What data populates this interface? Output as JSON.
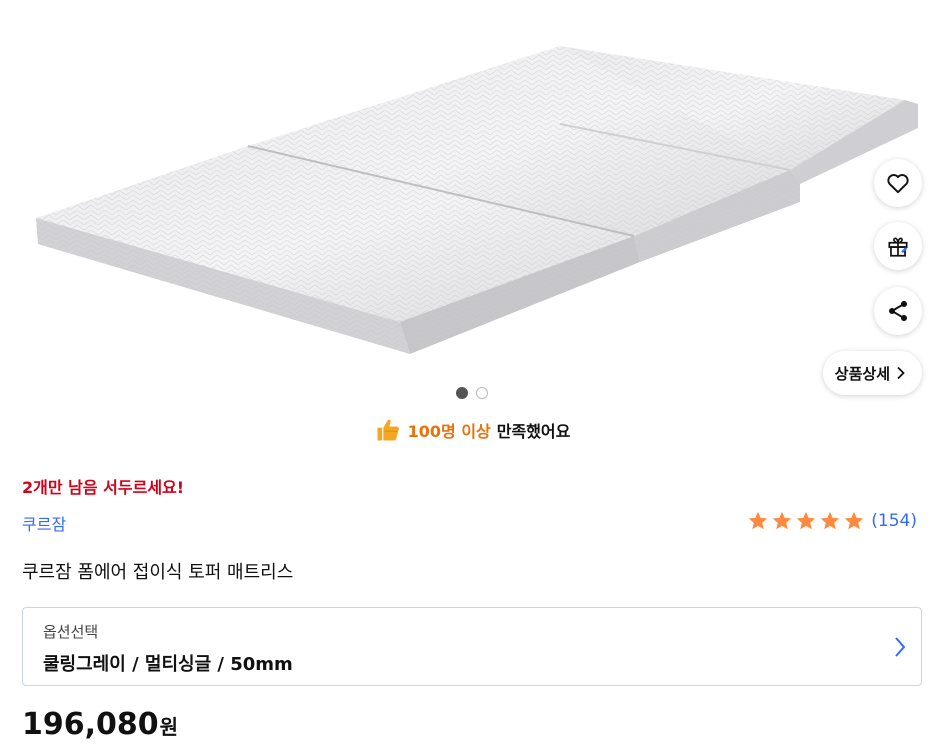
{
  "gallery": {
    "image_alt": "쿠르잠 폼에어 접이식 토퍼 매트리스",
    "dot_count": 2,
    "active_dot": 1
  },
  "actions": {
    "wish_icon": "heart-icon",
    "gift_icon": "gift-icon",
    "share_icon": "share-icon",
    "detail_label": "상품상세"
  },
  "satisfaction": {
    "icon": "thumbs-up-icon",
    "highlight": "100명 이상",
    "rest": "만족했어요",
    "highlight_color": "#e8720c"
  },
  "stock_notice": "2개만 남음 서두르세요!",
  "brand": "쿠르잠",
  "rating": {
    "stars": 5,
    "count": "(154)",
    "star_color": "#ff8a3d"
  },
  "product_title": "쿠르잠 폼에어 접이식 토퍼 매트리스",
  "option": {
    "label": "옵션선택",
    "value": "쿨링그레이 / 멀티싱글 / 50mm"
  },
  "price": {
    "amount": "196,080",
    "unit": "원"
  },
  "colors": {
    "accent_blue": "#346aff",
    "alert_red": "#d0021b"
  }
}
